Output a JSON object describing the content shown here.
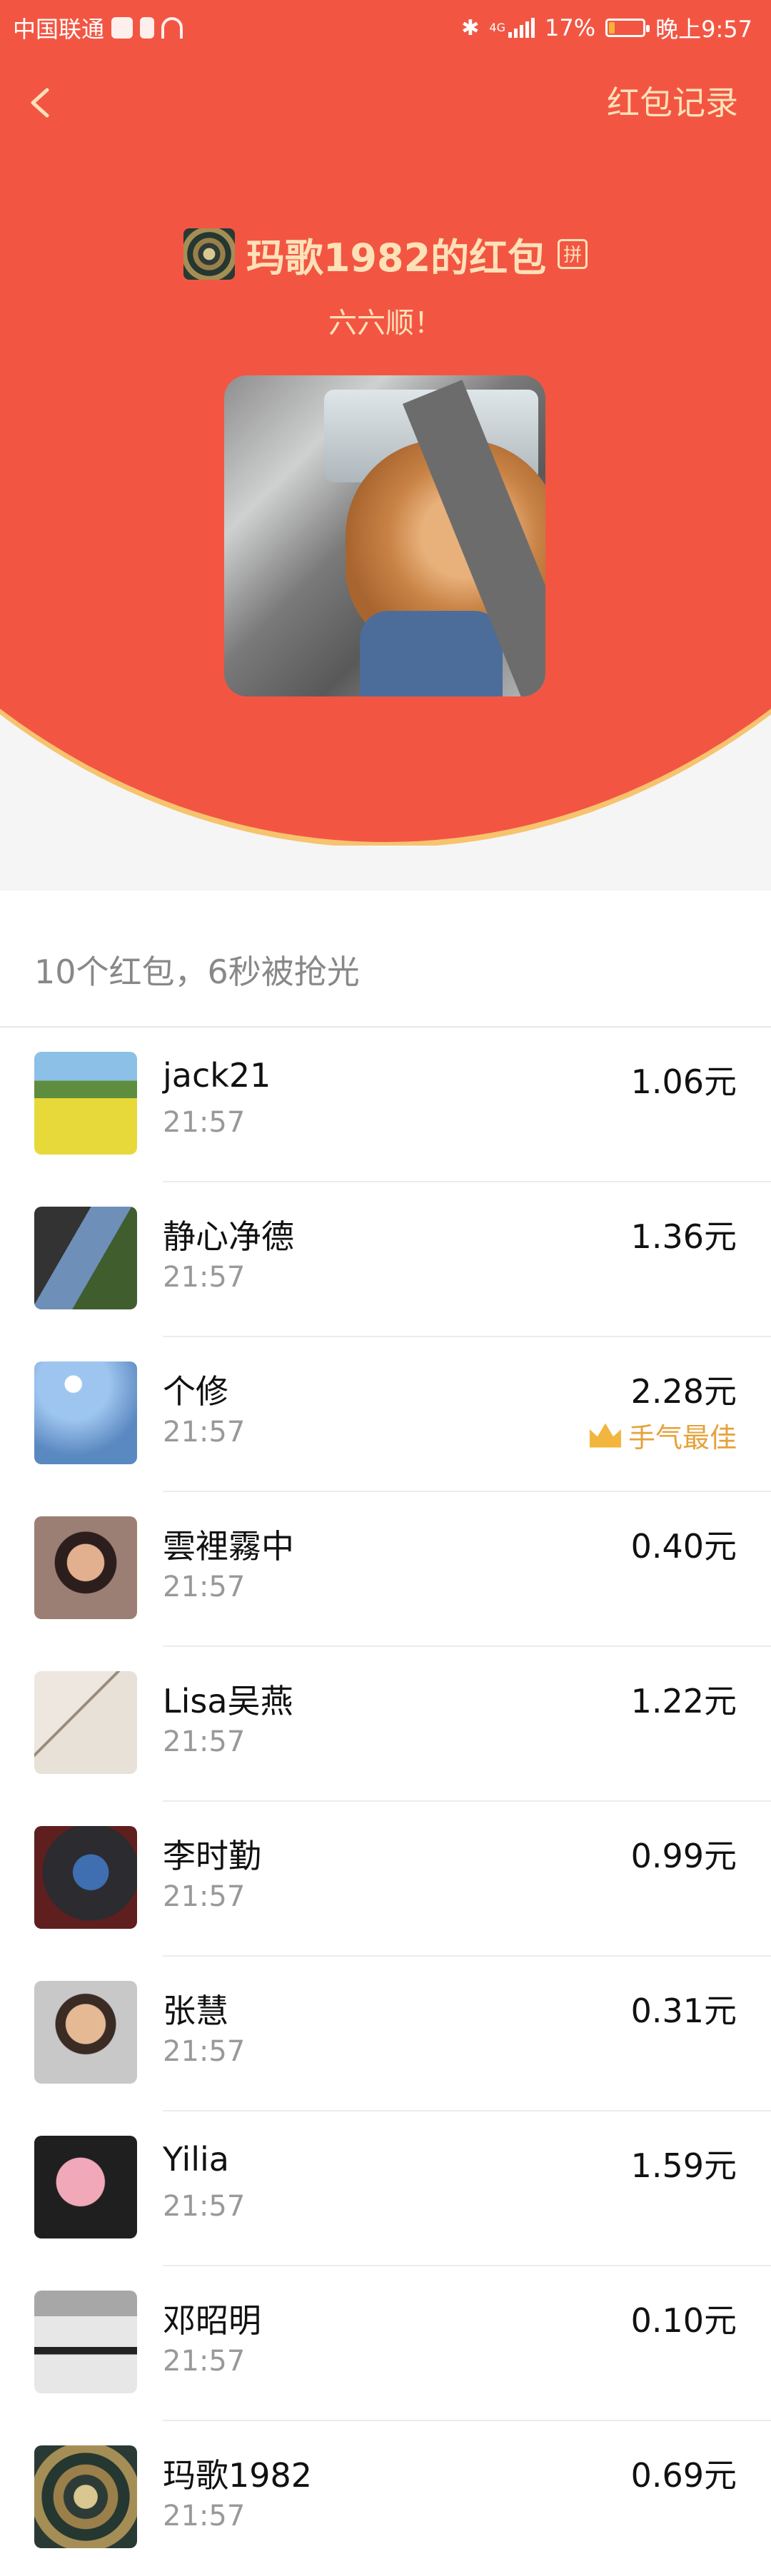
{
  "status_bar": {
    "carrier": "中国联通",
    "network": "4G",
    "battery_percent": "17%",
    "battery_level": 0.17,
    "time": "晚上9:57"
  },
  "header": {
    "back_icon": "chevron-left-icon",
    "records_label": "红包记录",
    "title": "玛歌1982的红包",
    "pin_badge": "拼",
    "wish": "六六顺！"
  },
  "summary": {
    "text": "10个红包，6秒被抢光"
  },
  "recipients": [
    {
      "name": "jack21",
      "time": "21:57",
      "amount": "1.06元",
      "best": ""
    },
    {
      "name": "静心净德",
      "time": "21:57",
      "amount": "1.36元",
      "best": ""
    },
    {
      "name": "个修",
      "time": "21:57",
      "amount": "2.28元",
      "best": "手气最佳"
    },
    {
      "name": "雲裡霧中",
      "time": "21:57",
      "amount": "0.40元",
      "best": ""
    },
    {
      "name": "Lisa吴燕",
      "time": "21:57",
      "amount": "1.22元",
      "best": ""
    },
    {
      "name": "李时勤",
      "time": "21:57",
      "amount": "0.99元",
      "best": ""
    },
    {
      "name": "张慧",
      "time": "21:57",
      "amount": "0.31元",
      "best": ""
    },
    {
      "name": "Yilia",
      "time": "21:57",
      "amount": "1.59元",
      "best": ""
    },
    {
      "name": "邓昭明",
      "time": "21:57",
      "amount": "0.10元",
      "best": ""
    },
    {
      "name": "玛歌1982",
      "time": "21:57",
      "amount": "0.69元",
      "best": ""
    }
  ],
  "colors": {
    "header_red": "#f25643",
    "header_text": "#ffe1b8",
    "best_gold": "#e6a13b"
  }
}
